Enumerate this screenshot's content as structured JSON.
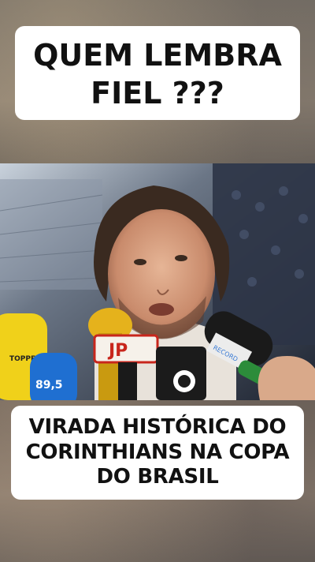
{
  "top_caption": {
    "line1": "QUEM LEMBRA",
    "line2": "FIEL ???"
  },
  "bottom_caption": {
    "line1": "VIRADA HISTÓRICA DO",
    "line2": "CORINTHIANS NA COPA",
    "line3": "DO BRASIL"
  },
  "video": {
    "mic_logo_jp": "JP",
    "mic_topper": "TOPPER",
    "mic_radio": "89,5",
    "mic_record": "RECORD"
  },
  "colors": {
    "caption_bg": "#ffffff",
    "caption_text": "#111111",
    "jp_red": "#c8261c"
  }
}
